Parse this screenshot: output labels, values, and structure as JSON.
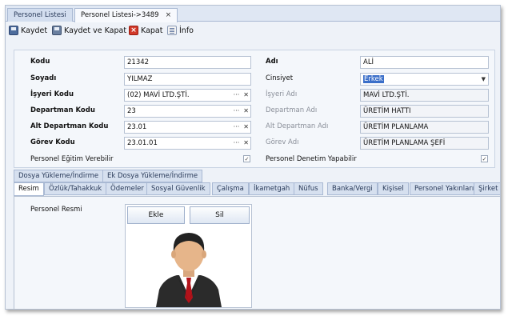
{
  "doc_tabs": {
    "tab1": "Personel Listesi",
    "tab2": "Personel Listesi->3489",
    "close": "×"
  },
  "toolbar": {
    "save": "Kaydet",
    "save_close": "Kaydet ve Kapat",
    "close": "Kapat",
    "info": "İnfo"
  },
  "form": {
    "kodu_label": "Kodu",
    "kodu_value": "21342",
    "adi_label": "Adı",
    "adi_value": "ALİ",
    "soyadi_label": "Soyadı",
    "soyadi_value": "YILMAZ",
    "cinsiyet_label": "Cinsiyet",
    "cinsiyet_value": "Erkek",
    "isyeri_kodu_label": "İşyeri Kodu",
    "isyeri_kodu_value": "(02) MAVİ LTD.ŞTİ.",
    "isyeri_adi_label": "İşyeri Adı",
    "isyeri_adi_value": "MAVİ LTD.ŞTİ.",
    "departman_kodu_label": "Departman Kodu",
    "departman_kodu_value": "23",
    "departman_adi_label": "Departman Adı",
    "departman_adi_value": "ÜRETİM HATTI",
    "alt_departman_kodu_label": "Alt Departman Kodu",
    "alt_departman_kodu_value": "23.01",
    "alt_departman_adi_label": "Alt Departman Adı",
    "alt_departman_adi_value": "ÜRETİM PLANLAMA",
    "gorev_kodu_label": "Görev Kodu",
    "gorev_kodu_value": "23.01.01",
    "gorev_adi_label": "Görev Adı",
    "gorev_adi_value": "ÜRETİM PLANLAMA ŞEFİ",
    "egitim_label": "Personel Eğitim Verebilir",
    "denetim_label": "Personel Denetim Yapabilir",
    "lookup_dots": "···",
    "clear_x": "✕",
    "check_mark": "✓"
  },
  "tabs_row1": [
    "Dosya Yükleme/İndirme",
    "Ek Dosya Yükleme/İndirme"
  ],
  "tabs_row2": [
    "Resim",
    "Özlük/Tahakkuk",
    "Ödemeler",
    "Sosyal Güvenlik",
    "Çalışma",
    "İkametgah",
    "Nüfus",
    "Banka/Vergi",
    "Kişisel",
    "Personel Yakınları",
    "Şirket"
  ],
  "content": {
    "resim_label": "Personel Resmi",
    "ekle": "Ekle",
    "sil": "Sil"
  },
  "colors": {
    "selection": "#3b6fc9",
    "accent_border": "#a9b9d3"
  }
}
